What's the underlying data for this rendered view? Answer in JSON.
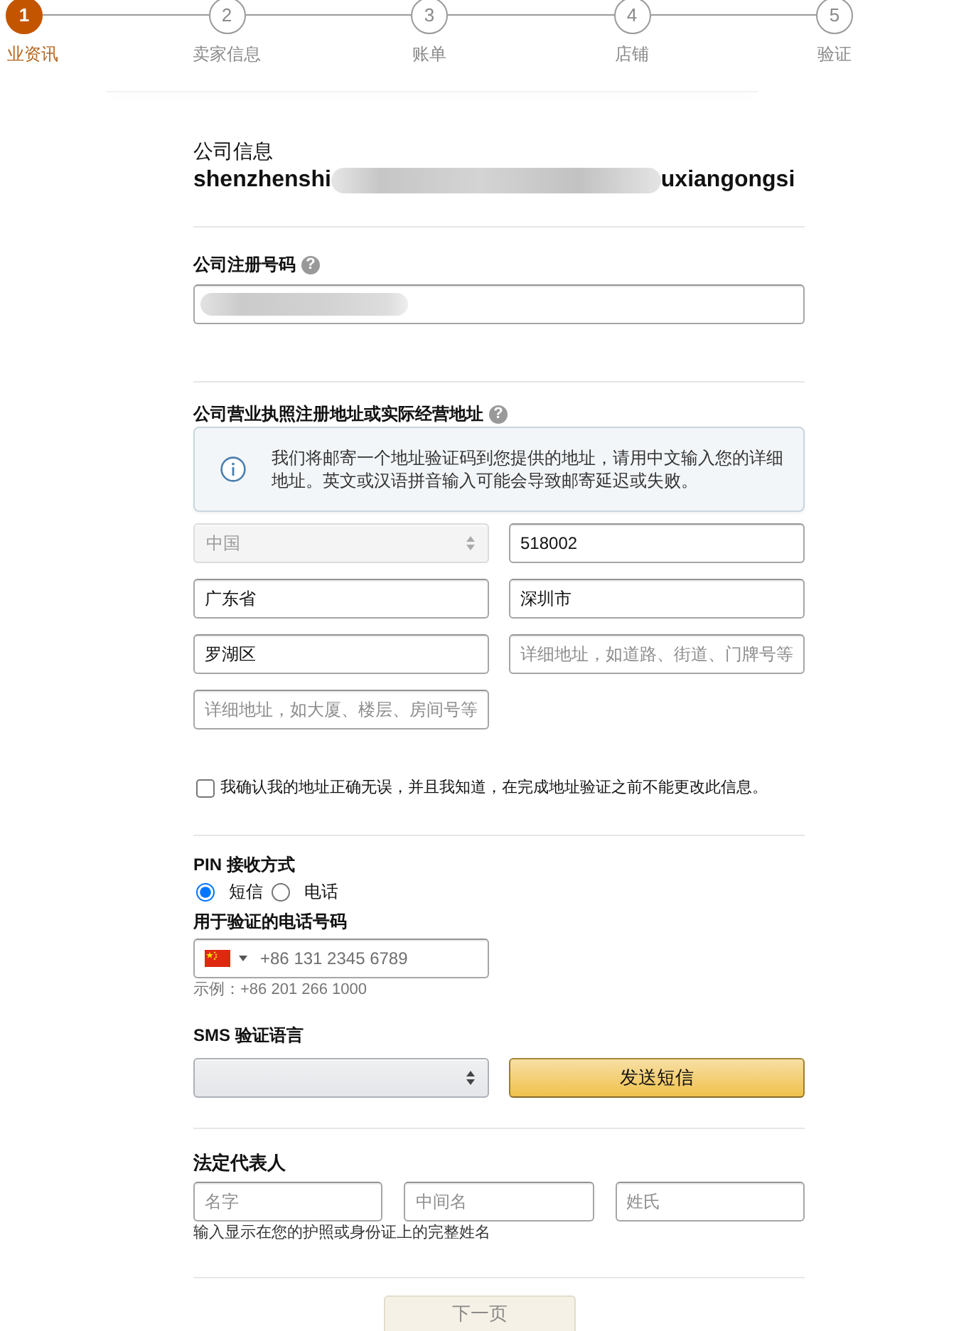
{
  "stepper": {
    "steps": [
      {
        "number": "1",
        "label": "业资讯",
        "selected": true
      },
      {
        "number": "2",
        "label": "卖家信息",
        "selected": false
      },
      {
        "number": "3",
        "label": "账单",
        "selected": false
      },
      {
        "number": "4",
        "label": "店铺",
        "selected": false
      },
      {
        "number": "5",
        "label": "验证",
        "selected": false
      }
    ]
  },
  "company_info": {
    "title": "公司信息",
    "name_start": "shenzhenshi",
    "name_end": "uxiangongsi"
  },
  "registration": {
    "label": "公司注册号码",
    "help": "?"
  },
  "address": {
    "label": "公司营业执照注册地址或实际经营地址",
    "help": "?",
    "notice": "我们将邮寄一个地址验证码到您提供的地址，请用中文输入您的详细地址。英文或汉语拼音输入可能会导致邮寄延迟或失败。",
    "fields": [
      {
        "kind": "select",
        "value": "中国",
        "disabled": true
      },
      {
        "kind": "input",
        "value": "518002",
        "disabled": false
      },
      {
        "kind": "input",
        "value": "广东省",
        "disabled": false
      },
      {
        "kind": "input",
        "value": "深圳市",
        "disabled": false
      },
      {
        "kind": "input",
        "value": "罗湖区",
        "disabled": false
      },
      {
        "kind": "input",
        "placeholder": "详细地址，如道路、街道、门牌号等",
        "disabled": false
      },
      {
        "kind": "input",
        "placeholder": "详细地址，如大厦、楼层、房间号等",
        "disabled": false
      }
    ]
  },
  "confirm": {
    "label": "我确认我的地址正确无误，并且我知道，在完成地址验证之前不能更改此信息。",
    "checked": false
  },
  "pin": {
    "label": "PIN 接收方式",
    "options": [
      {
        "label": "短信",
        "selected": true
      },
      {
        "label": "电话",
        "selected": false
      }
    ]
  },
  "phone": {
    "label": "用于验证的电话号码",
    "placeholder": "+86 131 2345 6789",
    "example": "示例：+86 201 266 1000"
  },
  "sms_language": {
    "label": "SMS 验证语言",
    "send_button": "发送短信"
  },
  "legal_representative": {
    "label": "法定代表人",
    "fields": [
      {
        "placeholder": "名字"
      },
      {
        "placeholder": "中间名"
      },
      {
        "placeholder": "姓氏"
      }
    ],
    "hint": "输入显示在您的护照或身份证上的完整姓名"
  },
  "next_button": {
    "label": "下一页",
    "disabled": true
  }
}
